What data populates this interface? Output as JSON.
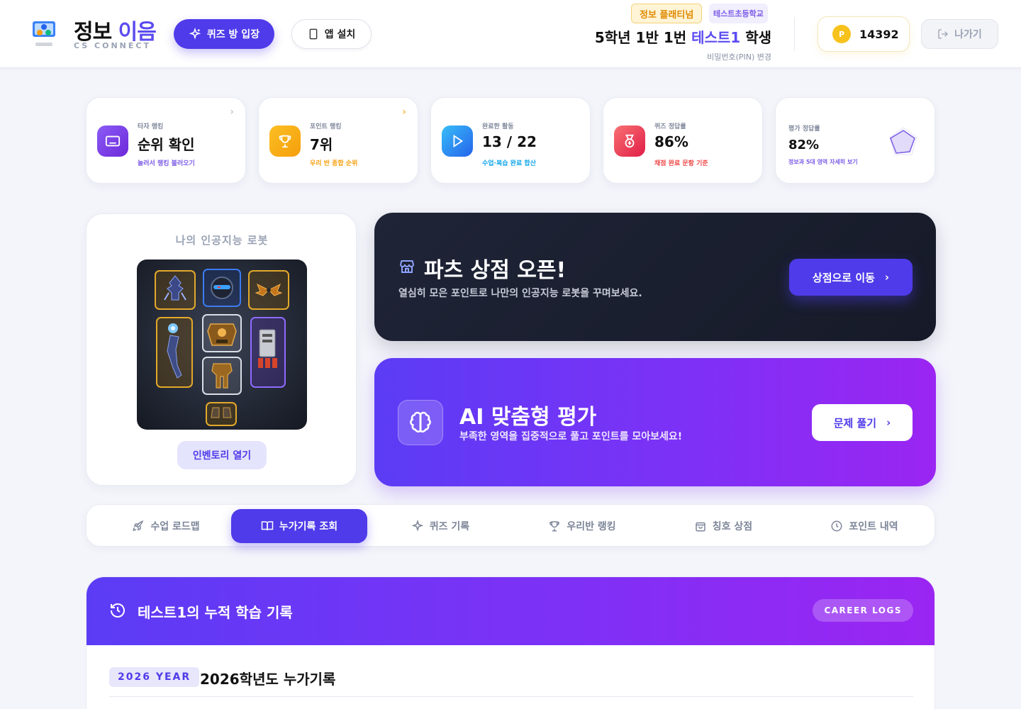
{
  "header": {
    "logo_title_main": "정보",
    "logo_title_accent": "이음",
    "logo_subtitle": "CS CONNECT",
    "quiz_button": "퀴즈 방 입장",
    "app_button": "앱 설치",
    "tier_badge": "정보 플래티넘",
    "school": "테스트초등학교",
    "student_prefix": "5학년 1반 1번 ",
    "student_name": "테스트1",
    "student_suffix": " 학생",
    "pin_link": "비밀번호(PIN) 변경",
    "points_coin": "P",
    "points": "14392",
    "exit_button": "나가기"
  },
  "stats": [
    {
      "label": "타자 랭킹",
      "value": "순위 확인",
      "sub": "놀러서 랭킹 불러오기",
      "color": "#7c5be6",
      "icon": "keyboard-icon"
    },
    {
      "label": "포인트 랭킹",
      "value": "7위",
      "sub": "우리 반 종합 순위",
      "color": "#f59e0b",
      "icon": "trophy-icon"
    },
    {
      "label": "완료한 활동",
      "value": "13 / 22",
      "sub": "수업·복습 완료 합산",
      "color": "#0ea5e9",
      "icon": "play-icon"
    },
    {
      "label": "퀴즈 정답률",
      "value": "86%",
      "sub": "채점 완료 문항 기준",
      "color": "#ef4444",
      "icon": "medal-icon"
    },
    {
      "label": "평가 정답률",
      "value": "82%",
      "sub": "정보과 5대 영역 자세히 보기",
      "color": "#7c5be6",
      "icon": "radar-chart-icon"
    }
  ],
  "robot": {
    "title": "나의 인공지능 로봇",
    "inventory_button": "인벤토리 열기"
  },
  "shop_banner": {
    "title": "파츠 상점 오픈!",
    "desc": "열심히 모은 포인트로 나만의 인공지능 로봇을 꾸며보세요.",
    "button": "상점으로 이동"
  },
  "ai_banner": {
    "title": "AI 맞춤형 평가",
    "desc": "부족한 영역을 집중적으로 풀고 포인트를 모아보세요!",
    "button": "문제 풀기"
  },
  "tabs": [
    {
      "label": "수업 로드맵",
      "icon": "rocket-icon",
      "active": false
    },
    {
      "label": "누가기록 조회",
      "icon": "book-icon",
      "active": true
    },
    {
      "label": "퀴즈 기록",
      "icon": "sparkle-icon",
      "active": false
    },
    {
      "label": "우리반 랭킹",
      "icon": "trophy-icon",
      "active": false
    },
    {
      "label": "칭호 상점",
      "icon": "shopping-bag-icon",
      "active": false
    },
    {
      "label": "포인트 내역",
      "icon": "clock-icon",
      "active": false
    }
  ],
  "logs": {
    "title": "테스트1의 누적 학습 기록",
    "pill": "CAREER LOGS",
    "year_badge": "2026 YEAR",
    "year_title": "2026학년도 누가기록"
  },
  "colors": {
    "accent": "#4f3be9",
    "gold": "#f7c21b",
    "dark_banner": "#1f2437",
    "purple_gradient_end": "#9b25f2"
  }
}
